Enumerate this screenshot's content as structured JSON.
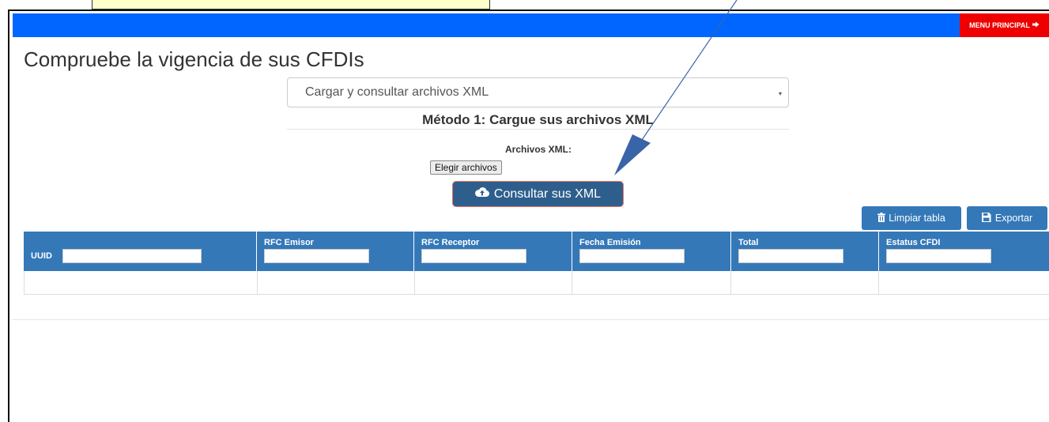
{
  "colors": {
    "topbar": "#0066ff",
    "menu_button": "#ee0000",
    "primary_button": "#2e5f8c",
    "table_header": "#3478b8",
    "annotation_arrow": "#3a64a8"
  },
  "menu": {
    "label": "MENU PRINCIPAL",
    "icon": "sign-out-icon"
  },
  "page": {
    "title": "Compruebe la vigencia de sus CFDIs"
  },
  "method_select": {
    "value": "Cargar y consultar archivos XML",
    "caret": "▾"
  },
  "method": {
    "heading": "Método 1: Cargue sus archivos XML"
  },
  "upload": {
    "label": "Archivos XML:",
    "file_button": "Elegir archivos",
    "submit_label": "Consultar sus XML",
    "submit_icon": "cloud-upload-icon"
  },
  "toolbar": {
    "clear_label": "Limpiar tabla",
    "clear_icon": "trash-icon",
    "export_label": "Exportar",
    "export_icon": "save-icon"
  },
  "table": {
    "columns": [
      "UUID",
      "RFC Emisor",
      "RFC Receptor",
      "Fecha Emisión",
      "Total",
      "Estatus CFDI"
    ],
    "rows": []
  }
}
